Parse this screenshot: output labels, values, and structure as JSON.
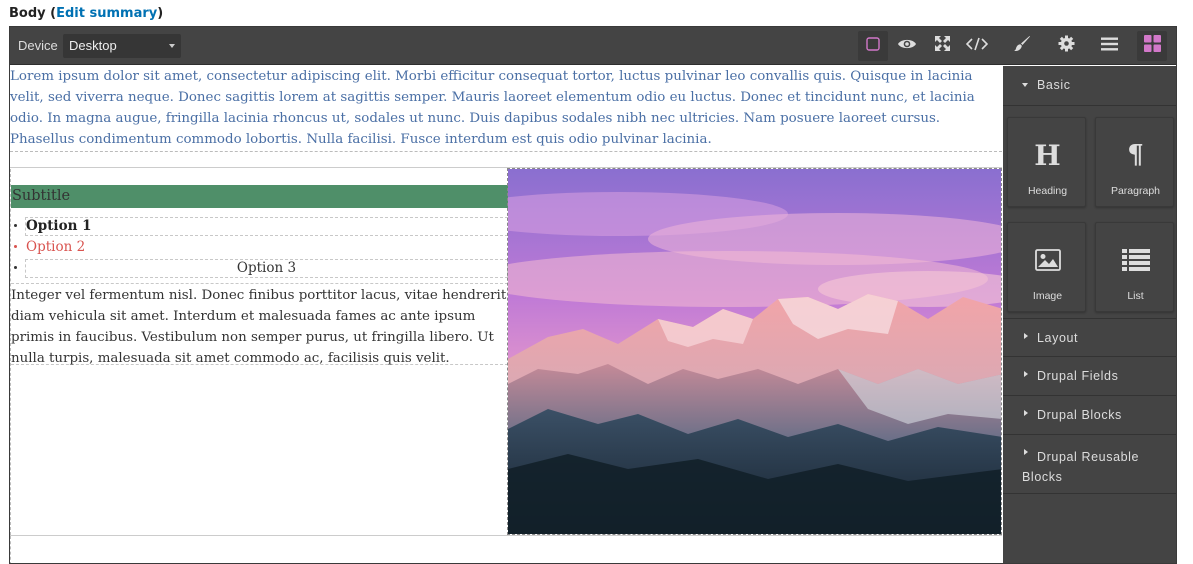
{
  "field": {
    "label": "Body",
    "open_paren": "(",
    "link": "Edit summary",
    "close_paren": ")"
  },
  "toolbar": {
    "device_label": "Device",
    "device_value": "Desktop",
    "buttons": [
      "sw-visibility-icon",
      "preview-eye-icon",
      "fullscreen-icon",
      "code-icon",
      "style-manager-brush-icon",
      "settings-gear-icon",
      "layer-manager-icon",
      "blocks-grid-icon"
    ]
  },
  "canvas": {
    "lorem": "Lorem ipsum dolor sit amet, consectetur adipiscing elit. Morbi efficitur consequat tortor, luctus pulvinar leo convallis quis. Quisque in lacinia velit, sed viverra neque. Donec sagittis lorem at sagittis semper. Mauris laoreet elementum odio eu luctus. Donec et tincidunt nunc, et lacinia odio. In magna augue, fringilla lacinia rhoncus ut, sodales ut nunc. Duis dapibus sodales nibh nec ultricies. Nam posuere laoreet cursus. Phasellus condimentum commodo lobortis. Nulla facilisi. Fusce interdum est quis odio pulvinar lacinia.",
    "subtitle": "Subtitle",
    "options": [
      "Option 1",
      "Option 2",
      "Option 3"
    ],
    "body_text": "Integer vel fermentum nisl. Donec finibus porttitor lacus, vitae hendrerit diam vehicula sit amet. Interdum et malesuada fames ac ante ipsum primis in faucibus. Vestibulum non semper purus, ut fringilla libero. Ut nulla turpis, malesuada sit amet commodo ac, facilisis quis velit."
  },
  "colors": {
    "toolbar_bg": "#444444",
    "active_accent": "#d278c9",
    "subtitle_bg": "#4f8f69",
    "lorem_text": "#4a6fa5",
    "option2_text": "#d9534f",
    "link": "#0071b3"
  },
  "panel": {
    "basic": "Basic",
    "blocks": [
      {
        "label": "Heading",
        "icon": "heading-h-icon"
      },
      {
        "label": "Paragraph",
        "icon": "paragraph-pilcrow-icon"
      },
      {
        "label": "Image",
        "icon": "image-icon"
      },
      {
        "label": "List",
        "icon": "list-icon"
      }
    ],
    "sections": [
      "Layout",
      "Drupal Fields",
      "Drupal Blocks",
      "Drupal Reusable Blocks"
    ]
  }
}
